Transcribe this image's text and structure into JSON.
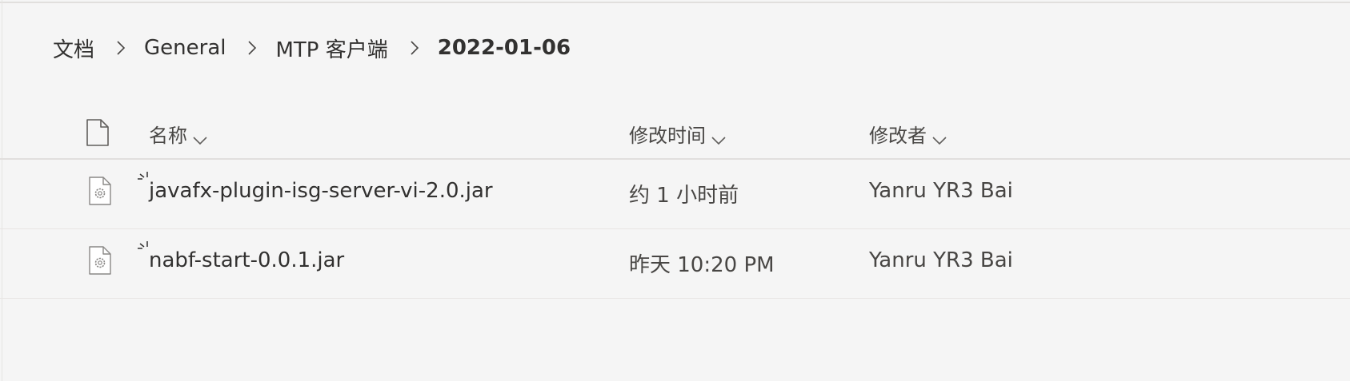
{
  "breadcrumb": {
    "items": [
      {
        "label": "文档"
      },
      {
        "label": "General"
      },
      {
        "label": "MTP 客户端"
      },
      {
        "label": "2022-01-06"
      }
    ]
  },
  "table": {
    "file_type_icon": "document-icon",
    "columns": {
      "name": "名称",
      "modified": "修改时间",
      "modified_by": "修改者"
    },
    "rows": [
      {
        "icon": "jar-file-icon",
        "sync_icon": "sync-pending-icon",
        "name": "javafx-plugin-isg-server-vi-2.0.jar",
        "modified": "约 1 小时前",
        "modified_by": "Yanru YR3 Bai"
      },
      {
        "icon": "jar-file-icon",
        "sync_icon": "sync-pending-icon",
        "name": "nabf-start-0.0.1.jar",
        "modified": "昨天 10:20 PM",
        "modified_by": "Yanru YR3 Bai"
      }
    ]
  }
}
